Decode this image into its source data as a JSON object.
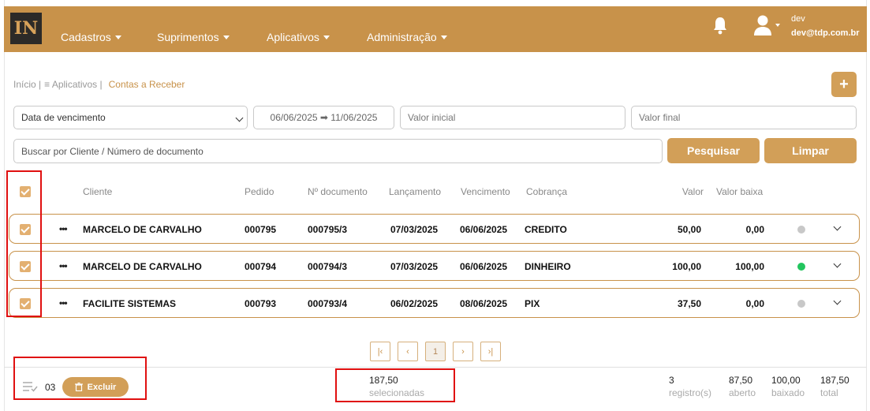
{
  "brand": {
    "logo_text": "IN"
  },
  "nav": [
    {
      "label": "Cadastros"
    },
    {
      "label": "Suprimentos"
    },
    {
      "label": "Aplicativos"
    },
    {
      "label": "Administração"
    }
  ],
  "user": {
    "name": "dev",
    "email": "dev@tdp.com.br"
  },
  "breadcrumb": {
    "home": "Início |",
    "apps": "≡ Aplicativos |",
    "current": "Contas a Receber"
  },
  "add_button": {
    "label": "+"
  },
  "filters": {
    "date_type": "Data de vencimento",
    "date_range": "06/06/2025 ➡ 11/06/2025",
    "valor_inicial_placeholder": "Valor inicial",
    "valor_final_placeholder": "Valor final",
    "search_placeholder": "Buscar por Cliente / Número de documento",
    "search_button": "Pesquisar",
    "clear_button": "Limpar"
  },
  "table": {
    "headers": {
      "cliente": "Cliente",
      "pedido": "Pedido",
      "documento": "Nº documento",
      "lancamento": "Lançamento",
      "vencimento": "Vencimento",
      "cobranca": "Cobrança",
      "valor": "Valor",
      "valor_baixa": "Valor baixa"
    },
    "rows": [
      {
        "menu": "•••",
        "cliente": "MARCELO DE CARVALHO",
        "pedido": "000795",
        "documento": "000795/3",
        "lancamento": "07/03/2025",
        "vencimento": "06/06/2025",
        "cobranca": "CREDITO",
        "valor": "50,00",
        "valor_baixa": "0,00",
        "status_color": "#c8c8c8",
        "checked": true
      },
      {
        "menu": "•••",
        "cliente": "MARCELO DE CARVALHO",
        "pedido": "000794",
        "documento": "000794/3",
        "lancamento": "07/03/2025",
        "vencimento": "06/06/2025",
        "cobranca": "DINHEIRO",
        "valor": "100,00",
        "valor_baixa": "100,00",
        "status_color": "#22c55e",
        "checked": true
      },
      {
        "menu": "•••",
        "cliente": "FACILITE SISTEMAS",
        "pedido": "000793",
        "documento": "000793/4",
        "lancamento": "06/02/2025",
        "vencimento": "08/06/2025",
        "cobranca": "PIX",
        "valor": "37,50",
        "valor_baixa": "0,00",
        "status_color": "#c8c8c8",
        "checked": true
      }
    ]
  },
  "pagination": {
    "first": "|‹",
    "prev": "‹",
    "current": "1",
    "next": "›",
    "last": "›|"
  },
  "footer": {
    "selected_count": "03",
    "delete_button": "Excluir",
    "selected_value": "187,50",
    "selected_label": "selecionadas",
    "registros_value": "3",
    "registros_label": "registro(s)",
    "aberto_value": "87,50",
    "aberto_label": "aberto",
    "baixado_value": "100,00",
    "baixado_label": "baixado",
    "total_value": "187,50",
    "total_label": "total"
  }
}
